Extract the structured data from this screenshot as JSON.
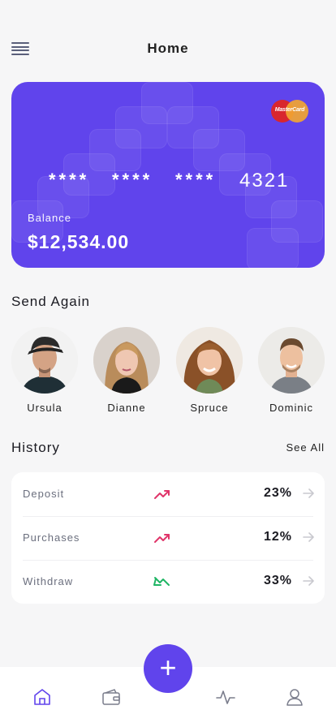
{
  "header": {
    "title": "Home"
  },
  "card": {
    "brand": "MasterCard",
    "masked_groups": [
      "****",
      "****",
      "****"
    ],
    "last_four": "4321",
    "balance_label": "Balance",
    "balance": "$12,534.00",
    "color": "#6044ec"
  },
  "send_again": {
    "title": "Send Again",
    "contacts": [
      {
        "name": "Ursula"
      },
      {
        "name": "Dianne"
      },
      {
        "name": "Spruce"
      },
      {
        "name": "Dominic"
      }
    ]
  },
  "history": {
    "title": "History",
    "see_all": "See All",
    "rows": [
      {
        "label": "Deposit",
        "percent": "23%",
        "trend": "up",
        "trend_color": "#e0356a"
      },
      {
        "label": "Purchases",
        "percent": "12%",
        "trend": "up",
        "trend_color": "#e0356a"
      },
      {
        "label": "Withdraw",
        "percent": "33%",
        "trend": "down",
        "trend_color": "#1fb564"
      }
    ]
  },
  "bottom_nav": {
    "items": [
      {
        "icon": "home-icon",
        "active": true
      },
      {
        "icon": "wallet-icon",
        "active": false
      },
      {
        "icon": "activity-icon",
        "active": false
      },
      {
        "icon": "user-icon",
        "active": false
      }
    ],
    "fab_icon": "plus-icon",
    "fab_label": "+",
    "accent": "#6044ec"
  }
}
